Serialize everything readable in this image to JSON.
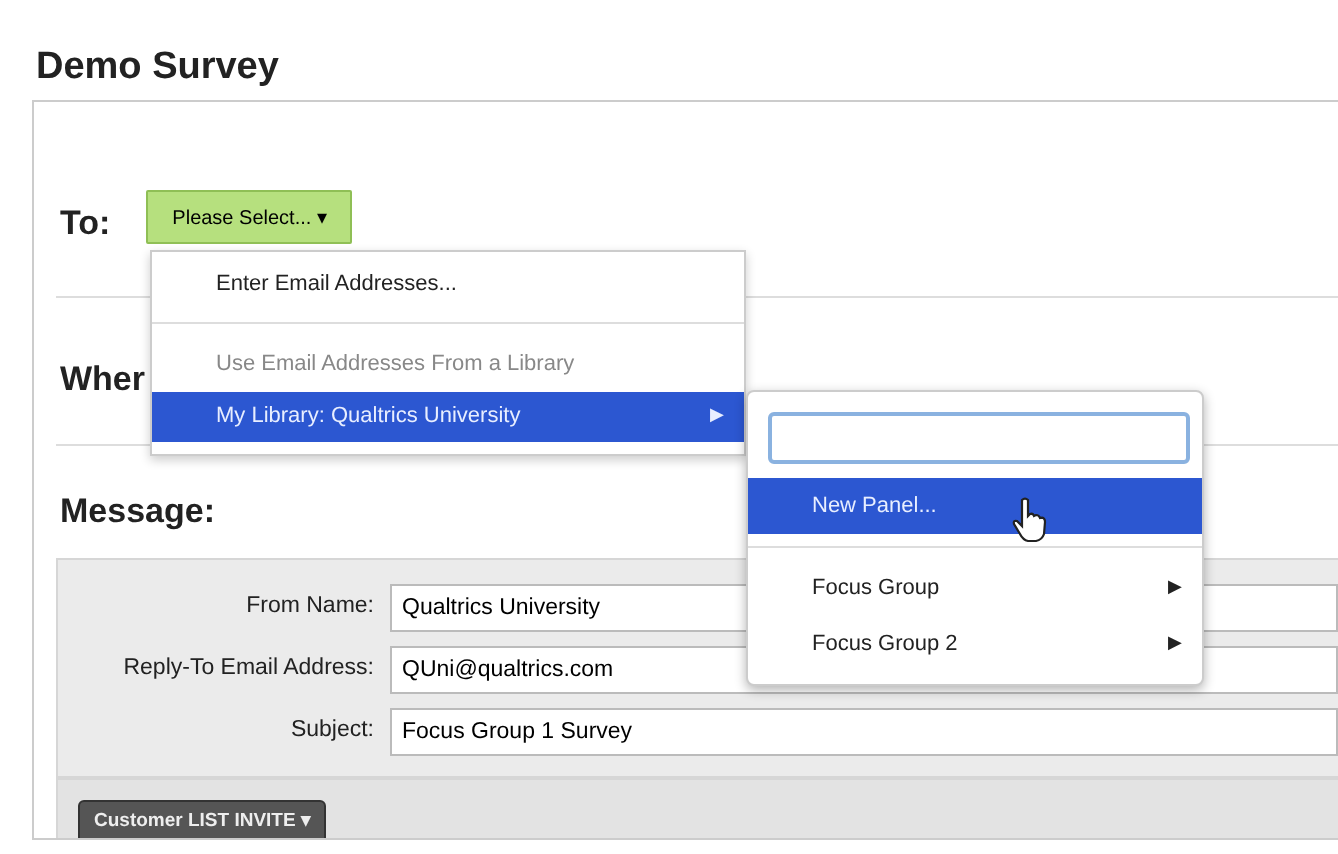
{
  "title": "Demo Survey",
  "to": {
    "label": "To:",
    "button": "Please Select...",
    "caret": "▾"
  },
  "when": {
    "label": "Wher"
  },
  "message": {
    "label": "Message:",
    "fields": [
      {
        "label": "From Name:",
        "value": "Qualtrics University"
      },
      {
        "label": "Reply-To Email Address:",
        "value": "QUni@qualtrics.com"
      },
      {
        "label": "Subject:",
        "value": "Focus Group 1 Survey"
      }
    ],
    "toolbar_button": {
      "label": "Customer LIST INVITE",
      "caret": "▾"
    }
  },
  "menu": {
    "items": [
      {
        "kind": "item",
        "label": "Enter Email Addresses...",
        "selected": false
      },
      {
        "kind": "separator"
      },
      {
        "kind": "header",
        "label": "Use Email Addresses From a Library"
      },
      {
        "kind": "item",
        "label": "My Library: Qualtrics University",
        "selected": true,
        "submenu": "▶"
      }
    ]
  },
  "submenu": {
    "items": [
      {
        "kind": "item",
        "label": "New Panel...",
        "selected": true
      },
      {
        "kind": "separator"
      },
      {
        "kind": "item",
        "label": "Focus Group",
        "selected": false,
        "submenu": "▶"
      },
      {
        "kind": "item",
        "label": "Focus Group 2",
        "selected": false,
        "submenu": "▶"
      }
    ]
  }
}
